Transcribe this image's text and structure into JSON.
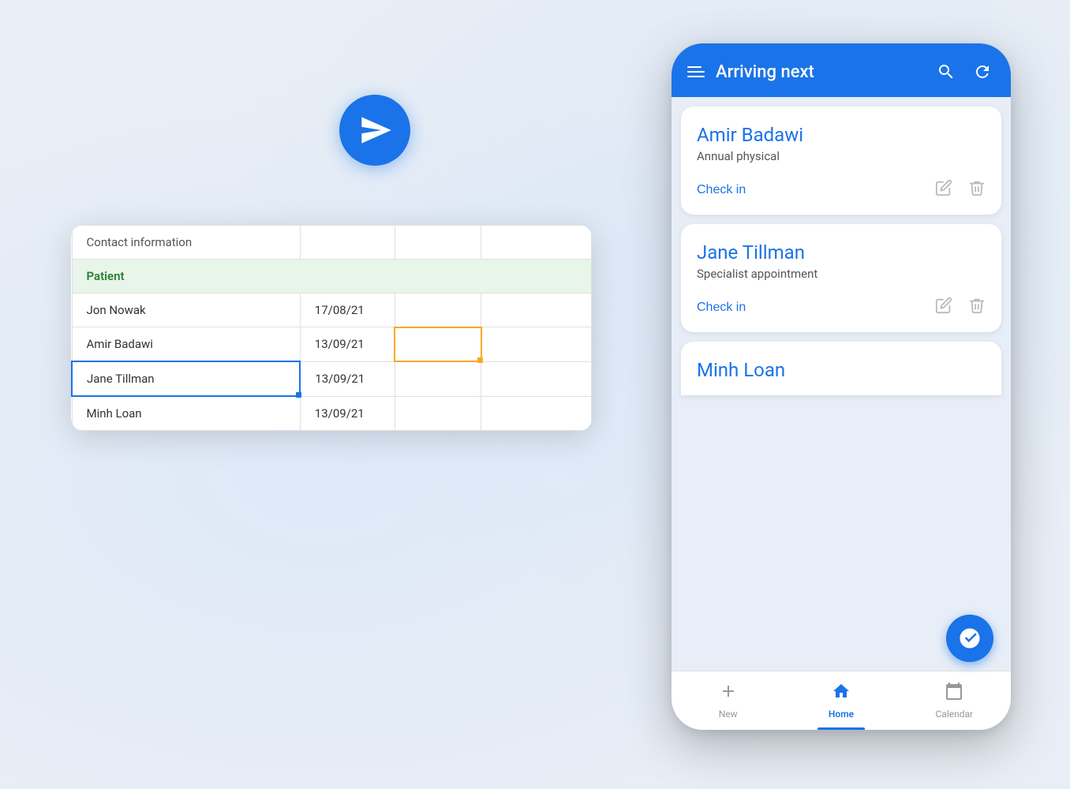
{
  "background": {
    "color": "#e8eef5"
  },
  "send_icon": {
    "label": "send-app-icon",
    "bg_color": "#1a73e8"
  },
  "spreadsheet": {
    "header_row": {
      "col1": "Contact information",
      "col2": "",
      "col3": "",
      "col4": ""
    },
    "patient_header": "Patient",
    "rows": [
      {
        "name": "Jon Nowak",
        "date": "17/08/21",
        "col3": "",
        "col4": ""
      },
      {
        "name": "Amir Badawi",
        "date": "13/09/21",
        "col3": "",
        "col4": ""
      },
      {
        "name": "Jane Tillman",
        "date": "13/09/21",
        "col3": "",
        "col4": ""
      },
      {
        "name": "Minh Loan",
        "date": "13/09/21",
        "col3": "",
        "col4": ""
      }
    ]
  },
  "phone": {
    "header": {
      "title": "Arriving next",
      "search_icon": "search",
      "refresh_icon": "refresh"
    },
    "cards": [
      {
        "name": "Amir Badawi",
        "appointment": "Annual physical",
        "check_in_label": "Check in",
        "edit_icon": "pencil",
        "delete_icon": "trash"
      },
      {
        "name": "Jane Tillman",
        "appointment": "Specialist appointment",
        "check_in_label": "Check in",
        "edit_icon": "pencil",
        "delete_icon": "trash"
      },
      {
        "name": "Minh Loan",
        "appointment": "",
        "check_in_label": "",
        "edit_icon": "",
        "delete_icon": ""
      }
    ],
    "fab": {
      "icon": "arrow-right-circle",
      "color": "#1a73e8"
    },
    "bottom_nav": [
      {
        "label": "New",
        "icon": "plus",
        "active": false
      },
      {
        "label": "Home",
        "icon": "home",
        "active": true
      },
      {
        "label": "Calendar",
        "icon": "calendar",
        "active": false
      }
    ]
  }
}
